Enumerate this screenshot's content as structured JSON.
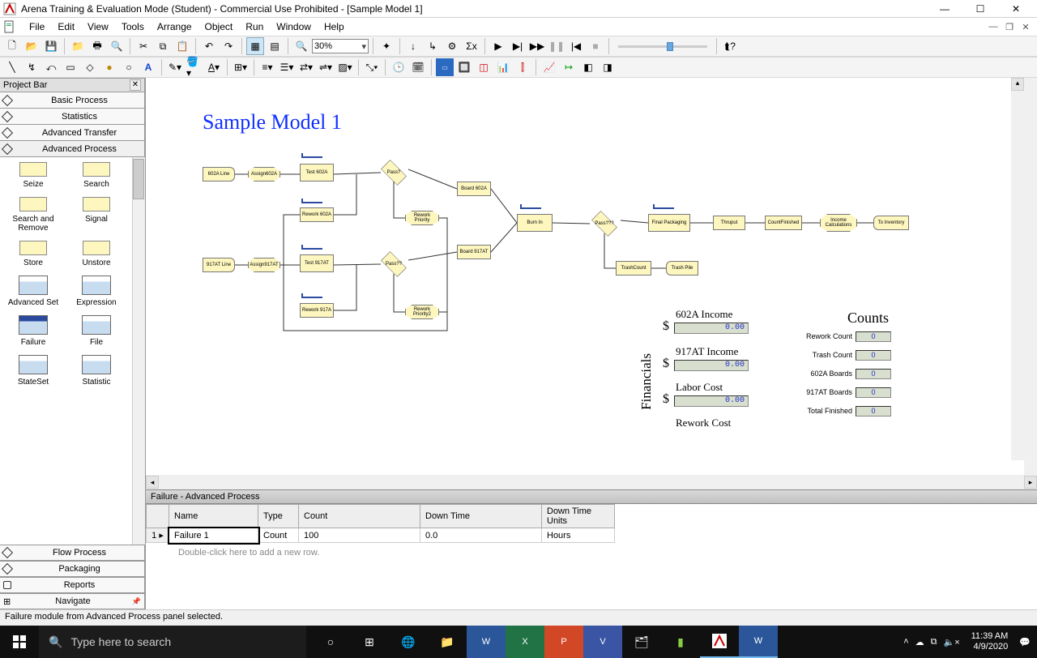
{
  "window": {
    "title": "Arena Training & Evaluation Mode (Student) - Commercial Use Prohibited - [Sample Model 1]"
  },
  "menu": {
    "items": [
      "File",
      "Edit",
      "View",
      "Tools",
      "Arrange",
      "Object",
      "Run",
      "Window",
      "Help"
    ]
  },
  "zoom": "30%",
  "projectbar": {
    "title": "Project Bar",
    "panels_top": [
      "Basic Process",
      "Statistics",
      "Advanced Transfer",
      "Advanced Process"
    ],
    "modules": [
      "Seize",
      "Search",
      "Search and Remove",
      "Signal",
      "Store",
      "Unstore",
      "Advanced Set",
      "Expression",
      "Failure",
      "File",
      "StateSet",
      "Statistic"
    ],
    "panels_bottom": [
      "Flow Process",
      "Packaging",
      "Reports",
      "Navigate"
    ]
  },
  "model": {
    "title": "Sample Model 1"
  },
  "blocks": {
    "a602line": "602A Line",
    "assign602a": "Assign602A",
    "test602a": "Test 602A",
    "passQ": "Pass?",
    "board602a": "Board 602A",
    "rework602a": "Rework 602A",
    "reworkPrio": "Rework Priority",
    "a917line": "917AT Line",
    "assign917": "Assign917AT",
    "test917": "Test 917AT",
    "pass2": "Pass??",
    "board917": "Board 917AT",
    "rework917": "Rework 917A",
    "reworkPrio2": "Rework Priority2",
    "burnin": "Burn In",
    "pass3": "Pass???",
    "finalpack": "Final Packaging",
    "thruput": "Thruput",
    "countfin": "CountFinished",
    "income": "Income Calculations",
    "toinv": "To Inventory",
    "trashcnt": "TrashCount",
    "trashpile": "Trash Pile"
  },
  "fin": {
    "l1": "602A Income",
    "v1": "0.00",
    "l2": "917AT Income",
    "v2": "0.00",
    "l3": "Labor Cost",
    "v3": "0.00",
    "l4": "Rework Cost",
    "side": "Financials"
  },
  "counts": {
    "title": "Counts",
    "rows": [
      {
        "label": "Rework Count",
        "val": "0"
      },
      {
        "label": "Trash Count",
        "val": "0"
      },
      {
        "label": "602A Boards",
        "val": "0"
      },
      {
        "label": "917AT Boards",
        "val": "0"
      },
      {
        "label": "Total Finished",
        "val": "0"
      }
    ]
  },
  "sheet": {
    "title": "Failure - Advanced Process",
    "cols": [
      "Name",
      "Type",
      "Count",
      "Down Time",
      "Down Time Units"
    ],
    "row": {
      "idx": "1",
      "name": "Failure 1",
      "type": "Count",
      "count": "100",
      "down": "0.0",
      "units": "Hours"
    },
    "hint": "Double-click here to add a new row."
  },
  "status": "Failure module from Advanced Process panel selected.",
  "taskbar": {
    "search_placeholder": "Type here to search",
    "time": "11:39 AM",
    "date": "4/9/2020"
  }
}
